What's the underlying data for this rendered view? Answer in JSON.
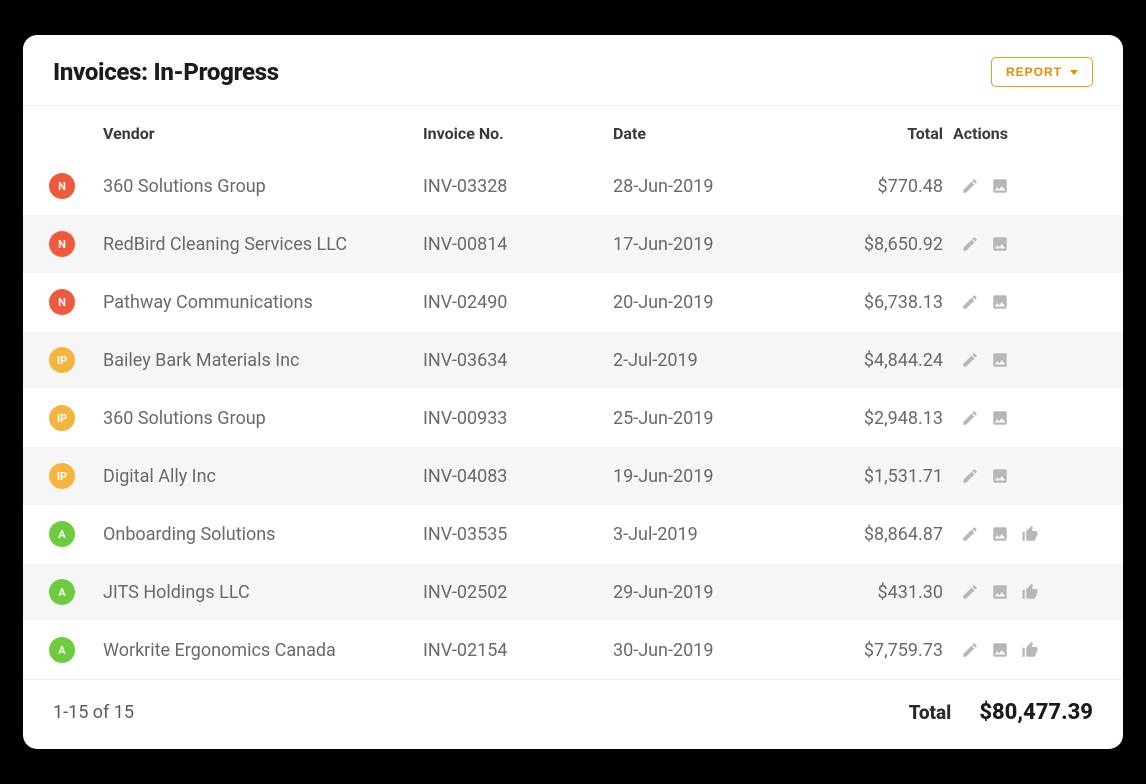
{
  "header": {
    "title": "Invoices: In-Progress",
    "report_label": "REPORT"
  },
  "columns": {
    "vendor": "Vendor",
    "invoice_no": "Invoice No.",
    "date": "Date",
    "total": "Total",
    "actions": "Actions"
  },
  "status_colors": {
    "N": "#f05a3c",
    "IP": "#f3b53d",
    "A": "#6ecb3f"
  },
  "rows": [
    {
      "status": "N",
      "vendor": "360 Solutions Group",
      "invoice_no": "INV-03328",
      "date": "28-Jun-2019",
      "total": "$770.48",
      "approvable": false
    },
    {
      "status": "N",
      "vendor": "RedBird Cleaning Services LLC",
      "invoice_no": "INV-00814",
      "date": "17-Jun-2019",
      "total": "$8,650.92",
      "approvable": false
    },
    {
      "status": "N",
      "vendor": "Pathway Communications",
      "invoice_no": "INV-02490",
      "date": "20-Jun-2019",
      "total": "$6,738.13",
      "approvable": false
    },
    {
      "status": "IP",
      "vendor": "Bailey Bark Materials Inc",
      "invoice_no": "INV-03634",
      "date": "2-Jul-2019",
      "total": "$4,844.24",
      "approvable": false
    },
    {
      "status": "IP",
      "vendor": "360 Solutions Group",
      "invoice_no": "INV-00933",
      "date": "25-Jun-2019",
      "total": "$2,948.13",
      "approvable": false
    },
    {
      "status": "IP",
      "vendor": "Digital Ally Inc",
      "invoice_no": "INV-04083",
      "date": "19-Jun-2019",
      "total": "$1,531.71",
      "approvable": false
    },
    {
      "status": "A",
      "vendor": "Onboarding Solutions",
      "invoice_no": "INV-03535",
      "date": "3-Jul-2019",
      "total": "$8,864.87",
      "approvable": true
    },
    {
      "status": "A",
      "vendor": "JITS Holdings LLC",
      "invoice_no": "INV-02502",
      "date": "29-Jun-2019",
      "total": "$431.30",
      "approvable": true
    },
    {
      "status": "A",
      "vendor": "Workrite Ergonomics Canada",
      "invoice_no": "INV-02154",
      "date": "30-Jun-2019",
      "total": "$7,759.73",
      "approvable": true
    }
  ],
  "footer": {
    "range": "1-15 of 15",
    "total_label": "Total",
    "total_value": "$80,477.39"
  }
}
